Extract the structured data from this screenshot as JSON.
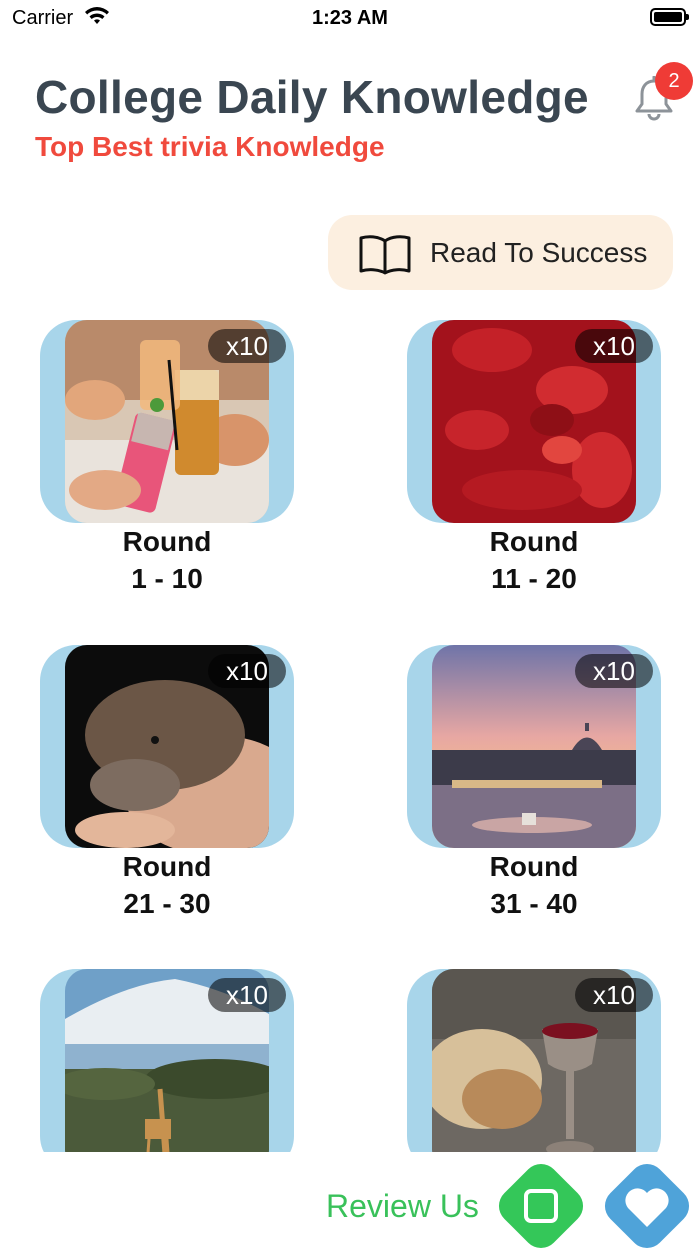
{
  "status": {
    "carrier": "Carrier",
    "time": "1:23 AM"
  },
  "header": {
    "title": "College Daily Knowledge",
    "subtitle": "Top Best trivia Knowledge",
    "notification_count": "2"
  },
  "read_button": {
    "label": "Read To Success",
    "icon": "book-icon"
  },
  "cards": [
    {
      "multiplier": "x10",
      "title": "Round",
      "range": "1 - 10",
      "image": "drinks-toast-photo"
    },
    {
      "multiplier": "x10",
      "title": "Round",
      "range": "11 - 20",
      "image": "blood-cells-photo"
    },
    {
      "multiplier": "x10",
      "title": "Round",
      "range": "21 - 30",
      "image": "platypus-photo"
    },
    {
      "multiplier": "x10",
      "title": "Round",
      "range": "31 - 40",
      "image": "rome-sunset-photo"
    },
    {
      "multiplier": "x10",
      "title": "",
      "range": "",
      "image": "kilimanjaro-giraffe-photo"
    },
    {
      "multiplier": "x10",
      "title": "",
      "range": "",
      "image": "bread-wine-photo"
    }
  ],
  "footer": {
    "review_label": "Review Us",
    "review_icon": "square-icon",
    "favorite_icon": "heart-icon"
  },
  "colors": {
    "title": "#3a4651",
    "subtitle": "#f04a3d",
    "card_frame": "#a8d5ea",
    "review": "#39c15a",
    "favorite": "#4fa3d9",
    "badge": "#ef3b36"
  }
}
